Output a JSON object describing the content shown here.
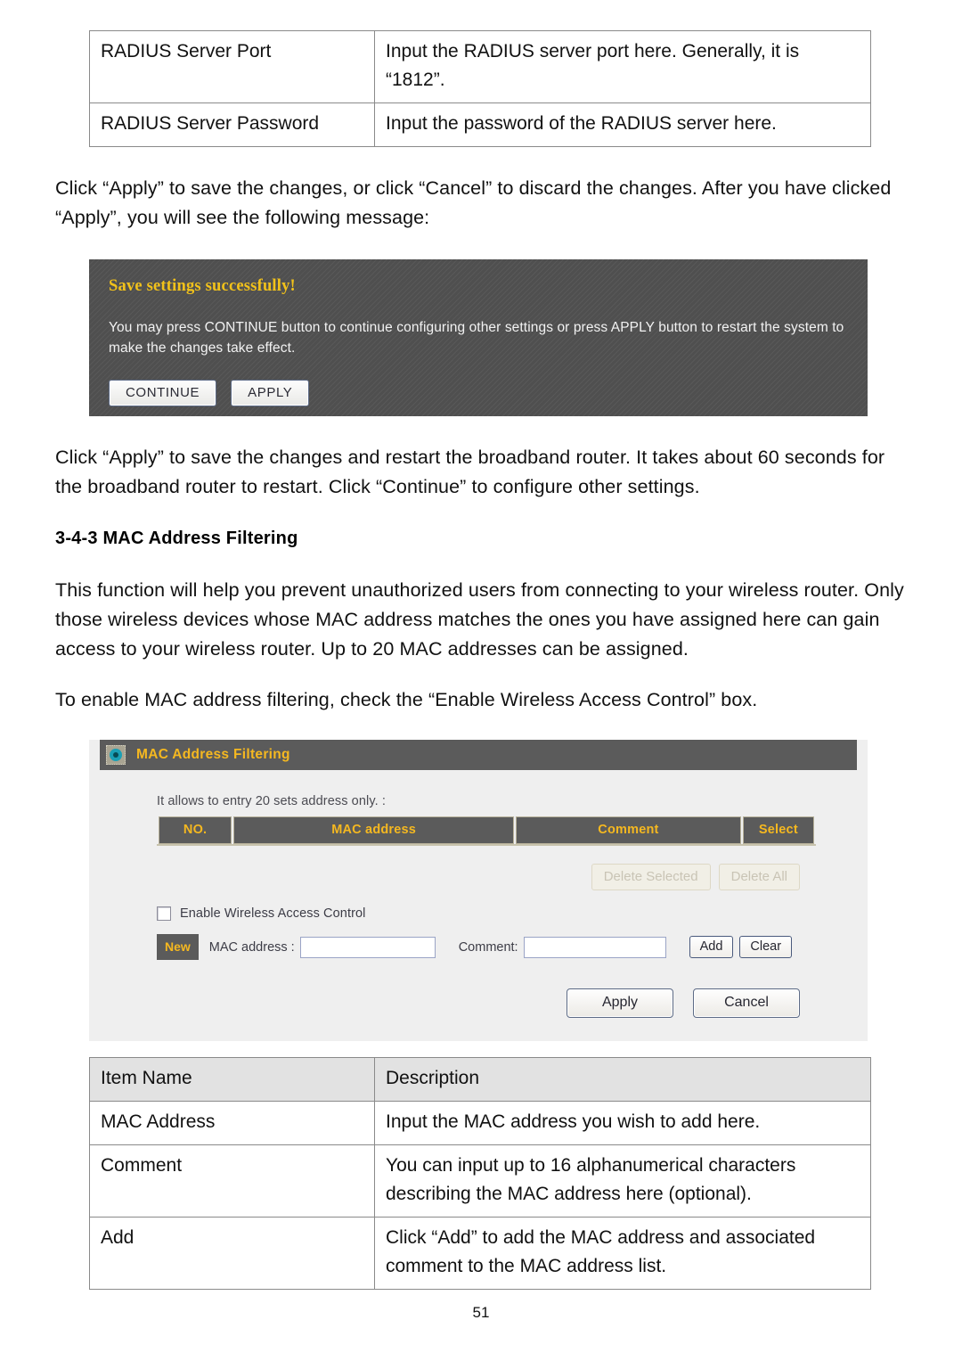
{
  "document": {
    "page_number": "51"
  },
  "radius_table": {
    "rows": [
      {
        "name": "RADIUS Server Port",
        "description": "Input the RADIUS server port here. Generally, it is “1812”."
      },
      {
        "name": "RADIUS Server Password",
        "description": "Input the password of the RADIUS server here."
      }
    ]
  },
  "paragraphs": {
    "apply_cancel": "Click “Apply” to save the changes, or click “Cancel” to discard the changes. After you have clicked “Apply”, you will see the following message:",
    "restart_note": "Click “Apply” to save the changes and restart the broadband router. It takes about 60 seconds for the broadband router to restart. Click “Continue” to configure other settings.",
    "mac_intro": "This function will help you prevent unauthorized users from connecting to your wireless router. Only those wireless devices whose MAC address matches the ones you have assigned here can gain access to your wireless router. Up to 20 MAC addresses can be assigned.",
    "enable_hint": "To enable MAC address filtering, check the “Enable Wireless Access Control” box."
  },
  "heading": {
    "mac_filtering": "3-4-3 MAC Address Filtering"
  },
  "router_message": {
    "title": "Save settings successfully!",
    "body": "You may press CONTINUE button to continue configuring other settings or press APPLY button to restart the system to make the changes take effect.",
    "buttons": {
      "continue": "CONTINUE",
      "apply": "APPLY"
    },
    "colors": {
      "background": "#4f4f4f",
      "title_text": "#f2c21a",
      "body_text": "#f2f2f2"
    }
  },
  "mac_panel": {
    "title": "MAC Address Filtering",
    "title_icon": "status-dot-icon",
    "note": "It allows to entry 20 sets address only. :",
    "table_headers": [
      "NO.",
      "MAC address",
      "Comment",
      "Select"
    ],
    "table_rows": [],
    "delete_buttons": {
      "delete_selected": "Delete Selected",
      "delete_all": "Delete All"
    },
    "enable_checkbox": {
      "label": "Enable Wireless Access Control",
      "checked": false
    },
    "new_badge": "New",
    "fields": {
      "mac_label": "MAC address :",
      "mac_value": "",
      "comment_label": "Comment:",
      "comment_value": ""
    },
    "row_buttons": {
      "add": "Add",
      "clear": "Clear"
    },
    "footer_buttons": {
      "apply": "Apply",
      "cancel": "Cancel"
    },
    "colors": {
      "panel_background": "#efefef",
      "titlebar": "#5b5b5b",
      "accent_text": "#f5b820"
    }
  },
  "item_table": {
    "headers": [
      "Item Name",
      "Description"
    ],
    "rows": [
      {
        "name": "MAC Address",
        "description": "Input the MAC address you wish to add here."
      },
      {
        "name": "Comment",
        "description": "You can input up to 16 alphanumerical characters describing the MAC address here (optional)."
      },
      {
        "name": "Add",
        "description": "Click “Add” to add the MAC address and associated comment to the MAC address list."
      }
    ]
  }
}
